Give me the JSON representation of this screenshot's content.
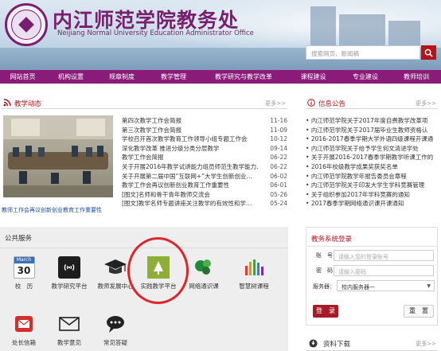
{
  "header": {
    "title": "内江师范学院教务处",
    "subtitle": "Neijiang Normal University Education Administrator Office",
    "search_placeholder": "搜索网页、新闻稿"
  },
  "nav": [
    "网站首页",
    "机构设置",
    "规章制度",
    "教学管理",
    "教学研究与教学改革",
    "课程建设",
    "专业建设",
    "教师培训"
  ],
  "teaching_news": {
    "title": "教学动态",
    "more": "更多>>",
    "caption": "教师工作会再议创新创业教育工作重要性",
    "items": [
      {
        "title": "第四次教学工作会简报",
        "date": "11-16"
      },
      {
        "title": "第三次教学工作会简报",
        "date": "11-09"
      },
      {
        "title": "学校召开首次教学教育工作领导小组专题工作会",
        "date": "10-12"
      },
      {
        "title": "深化教学改革 推进分级分类分层教学",
        "date": "09-14"
      },
      {
        "title": "教学工作会简报",
        "date": "06-22"
      },
      {
        "title": "关于开展2016年教学试讲能力组员师范生教学能力…",
        "date": "06-22"
      },
      {
        "title": "关于开展第二届中国“互联网+”大学生创新创业…",
        "date": "06-02"
      },
      {
        "title": "教学工作会再议创新创业教育工作重要性",
        "date": "06-01"
      },
      {
        "title": "[图文]名师和骨干青年教师交流会",
        "date": "05-26"
      },
      {
        "title": "[图文]教学名师专题讲座关注教学的有效性和学…",
        "date": "05-24"
      }
    ]
  },
  "notices": {
    "title": "信息公告",
    "more": "更多>>",
    "items": [
      "内江师范学院关于2017年度自费教学改革项",
      "内江师范学院关于2017届毕业生教师资格认",
      "2016-2017春季学期大学外语四级课程开课通",
      "内江师范学院关于给予学生何文清进学处",
      "关于开展2016-2017春季学期教学听课工作的",
      "2016年校级教学成果奖获奖名单",
      "内江师范学院教学年报告委员会章程",
      "内江师范学院关于印发大学生学科竞赛管理",
      "关于组织参加2017年学科竞赛的通知",
      "2017春季学期网络通识课开课通知"
    ]
  },
  "services": {
    "title": "公共服务",
    "calendar": {
      "month": "March",
      "day": "30"
    },
    "items": [
      {
        "label": "校　历",
        "icon": "calendar-icon"
      },
      {
        "label": "教学研究平台",
        "icon": "wifi-icon"
      },
      {
        "label": "教师发展中心",
        "icon": "graduation-cap-icon"
      },
      {
        "label": "实践教学平台",
        "icon": "tree-icon"
      },
      {
        "label": "网络通识课",
        "icon": "dots-cluster-icon"
      },
      {
        "label": "智慧树课程",
        "icon": "bars-icon"
      },
      {
        "label": "处长信箱",
        "icon": "mailbox-icon"
      },
      {
        "label": "教学意见",
        "icon": "envelope-icon"
      },
      {
        "label": "常见答疑",
        "icon": "chat-icon"
      }
    ]
  },
  "login": {
    "title": "教务系统登录",
    "account_label": "账　号：",
    "account_placeholder": "请输入您的登录账号",
    "password_label": "密　码：",
    "password_placeholder": "请输入密码",
    "server_label": "服务器：",
    "server_value": "校内服务器一",
    "login_button": "登　录",
    "reset_button": "重　置"
  },
  "downloads": {
    "title": "资料下载",
    "more": "更多>>"
  },
  "colors": {
    "brand_purple": "#8a1b78",
    "accent_red": "#b3141c",
    "highlight_ring": "#d9272d"
  }
}
